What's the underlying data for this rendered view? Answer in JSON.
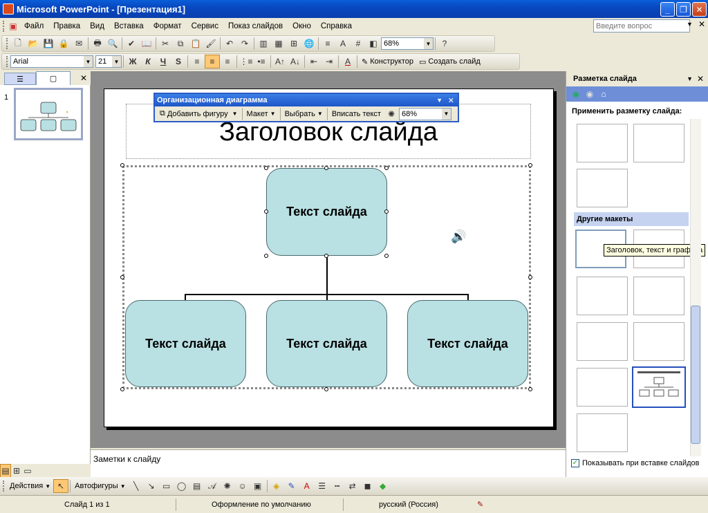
{
  "window": {
    "title": "Microsoft PowerPoint - [Презентация1]"
  },
  "menu": [
    "Файл",
    "Правка",
    "Вид",
    "Вставка",
    "Формат",
    "Сервис",
    "Показ слайдов",
    "Окно",
    "Справка"
  ],
  "help": {
    "placeholder": "Введите вопрос"
  },
  "standard": {
    "zoom": "68%"
  },
  "formatting": {
    "font": "Arial",
    "size": "21",
    "bold": "Ж",
    "italic": "К",
    "underline": "Ч",
    "shadow": "S",
    "designer": "Конструктор",
    "new_slide": "Создать слайд"
  },
  "slides_pane": {
    "slide_number": "1"
  },
  "slide": {
    "title": "Заголовок слайда",
    "top_box": "Текст слайда",
    "boxes": [
      "Текст слайда",
      "Текст слайда",
      "Текст слайда"
    ]
  },
  "org_toolbar": {
    "title": "Организационная диаграмма",
    "add_shape": "Добавить фигуру",
    "layout": "Макет",
    "select": "Выбрать",
    "fit_text": "Вписать текст",
    "zoom": "68%"
  },
  "notes": {
    "placeholder": "Заметки к слайду"
  },
  "taskpane": {
    "title": "Разметка слайда",
    "apply_label": "Применить разметку слайда:",
    "other_layouts": "Другие макеты",
    "tooltip": "Заголовок, текст и графика",
    "show_on_insert": "Показывать при вставке слайдов"
  },
  "drawing": {
    "actions": "Действия",
    "autoshapes": "Автофигуры"
  },
  "status": {
    "slide": "Слайд 1 из 1",
    "design": "Оформление по умолчанию",
    "language": "русский (Россия)"
  }
}
